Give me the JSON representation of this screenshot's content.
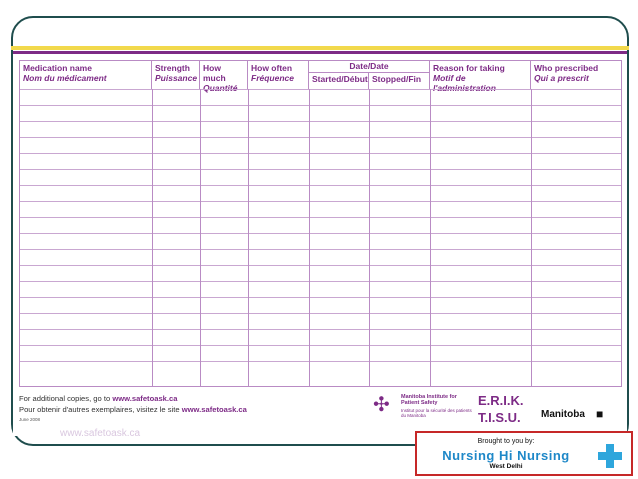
{
  "columns": {
    "medication": {
      "en": "Medication name",
      "fr": "Nom du médicament"
    },
    "strength": {
      "en": "Strength",
      "fr": "Puissance"
    },
    "how_much": {
      "en": "How much",
      "fr": "Quantité"
    },
    "how_often": {
      "en": "How often",
      "fr": "Fréquence"
    },
    "date_group": "Date/Date",
    "started": "Started/Début",
    "stopped": "Stopped/Fin",
    "reason": {
      "en": "Reason for taking",
      "fr": "Motif de l'administration"
    },
    "prescribed": {
      "en": "Who prescribed",
      "fr": "Qui a prescrit"
    }
  },
  "footer": {
    "copies_en_prefix": "For additional copies, go to",
    "copies_en_link": "www.safetoask.ca",
    "copies_fr_prefix": "Pour obtenir d'autres exemplaires, visitez le site",
    "copies_fr_link": "www.safetoask.ca",
    "date_note": "June 2008"
  },
  "logos": {
    "mips_en": "Manitoba Institute for Patient Safety",
    "mips_fr": "Institut pour la sécurité des patients du Manitoba",
    "erik": "E.R.I.K.",
    "tisu": "T.I.S.U.",
    "manitoba": "Manitoba"
  },
  "ghost_text": "www.safetoask.ca",
  "ad": {
    "brought": "Brought to you by:",
    "title": "Nursing Hi Nursing",
    "subtitle": "West Delhi"
  },
  "colors": {
    "accent": "#7d2b86",
    "frame": "#1f4d4d",
    "topline": "#f2d94c",
    "ad_border": "#c62828",
    "ad_blue": "#1e88c8"
  }
}
